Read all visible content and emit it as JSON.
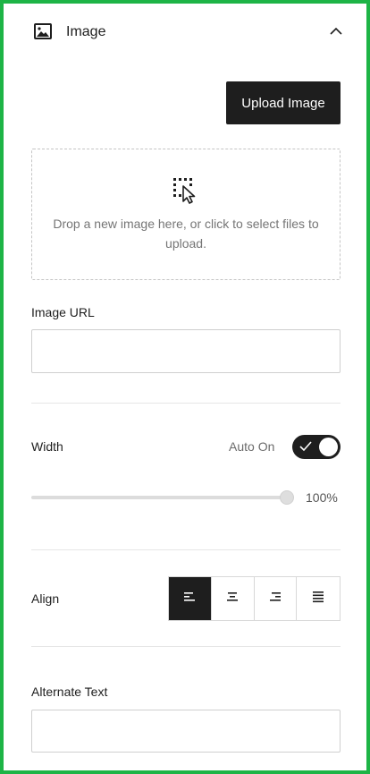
{
  "panel": {
    "title": "Image",
    "header_icon": "image-icon",
    "collapse_icon": "chevron-up-icon"
  },
  "upload": {
    "button_label": "Upload Image",
    "drop_icon": "drop-select-icon",
    "drop_text": "Drop a new image here, or click to select files to upload."
  },
  "image_url": {
    "label": "Image URL",
    "value": ""
  },
  "width": {
    "label": "Width",
    "auto_label": "Auto On",
    "auto_on": true,
    "slider_value_fraction": 1.0,
    "value_text": "100%"
  },
  "align": {
    "label": "Align",
    "options": [
      "left",
      "center",
      "right",
      "justify"
    ],
    "selected": "left"
  },
  "alt_text": {
    "label": "Alternate Text",
    "value": ""
  },
  "colors": {
    "frame_border": "#1db446",
    "dark": "#1e1e1e"
  }
}
